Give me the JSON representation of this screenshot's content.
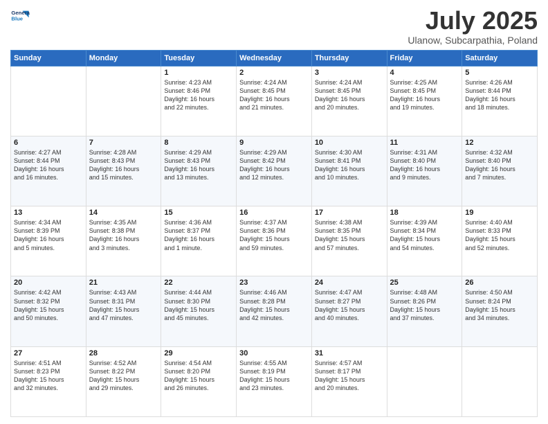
{
  "header": {
    "logo_line1": "General",
    "logo_line2": "Blue",
    "title": "July 2025",
    "location": "Ulanow, Subcarpathia, Poland"
  },
  "days_of_week": [
    "Sunday",
    "Monday",
    "Tuesday",
    "Wednesday",
    "Thursday",
    "Friday",
    "Saturday"
  ],
  "weeks": [
    [
      {
        "day": "",
        "info": ""
      },
      {
        "day": "",
        "info": ""
      },
      {
        "day": "1",
        "info": "Sunrise: 4:23 AM\nSunset: 8:46 PM\nDaylight: 16 hours\nand 22 minutes."
      },
      {
        "day": "2",
        "info": "Sunrise: 4:24 AM\nSunset: 8:45 PM\nDaylight: 16 hours\nand 21 minutes."
      },
      {
        "day": "3",
        "info": "Sunrise: 4:24 AM\nSunset: 8:45 PM\nDaylight: 16 hours\nand 20 minutes."
      },
      {
        "day": "4",
        "info": "Sunrise: 4:25 AM\nSunset: 8:45 PM\nDaylight: 16 hours\nand 19 minutes."
      },
      {
        "day": "5",
        "info": "Sunrise: 4:26 AM\nSunset: 8:44 PM\nDaylight: 16 hours\nand 18 minutes."
      }
    ],
    [
      {
        "day": "6",
        "info": "Sunrise: 4:27 AM\nSunset: 8:44 PM\nDaylight: 16 hours\nand 16 minutes."
      },
      {
        "day": "7",
        "info": "Sunrise: 4:28 AM\nSunset: 8:43 PM\nDaylight: 16 hours\nand 15 minutes."
      },
      {
        "day": "8",
        "info": "Sunrise: 4:29 AM\nSunset: 8:43 PM\nDaylight: 16 hours\nand 13 minutes."
      },
      {
        "day": "9",
        "info": "Sunrise: 4:29 AM\nSunset: 8:42 PM\nDaylight: 16 hours\nand 12 minutes."
      },
      {
        "day": "10",
        "info": "Sunrise: 4:30 AM\nSunset: 8:41 PM\nDaylight: 16 hours\nand 10 minutes."
      },
      {
        "day": "11",
        "info": "Sunrise: 4:31 AM\nSunset: 8:40 PM\nDaylight: 16 hours\nand 9 minutes."
      },
      {
        "day": "12",
        "info": "Sunrise: 4:32 AM\nSunset: 8:40 PM\nDaylight: 16 hours\nand 7 minutes."
      }
    ],
    [
      {
        "day": "13",
        "info": "Sunrise: 4:34 AM\nSunset: 8:39 PM\nDaylight: 16 hours\nand 5 minutes."
      },
      {
        "day": "14",
        "info": "Sunrise: 4:35 AM\nSunset: 8:38 PM\nDaylight: 16 hours\nand 3 minutes."
      },
      {
        "day": "15",
        "info": "Sunrise: 4:36 AM\nSunset: 8:37 PM\nDaylight: 16 hours\nand 1 minute."
      },
      {
        "day": "16",
        "info": "Sunrise: 4:37 AM\nSunset: 8:36 PM\nDaylight: 15 hours\nand 59 minutes."
      },
      {
        "day": "17",
        "info": "Sunrise: 4:38 AM\nSunset: 8:35 PM\nDaylight: 15 hours\nand 57 minutes."
      },
      {
        "day": "18",
        "info": "Sunrise: 4:39 AM\nSunset: 8:34 PM\nDaylight: 15 hours\nand 54 minutes."
      },
      {
        "day": "19",
        "info": "Sunrise: 4:40 AM\nSunset: 8:33 PM\nDaylight: 15 hours\nand 52 minutes."
      }
    ],
    [
      {
        "day": "20",
        "info": "Sunrise: 4:42 AM\nSunset: 8:32 PM\nDaylight: 15 hours\nand 50 minutes."
      },
      {
        "day": "21",
        "info": "Sunrise: 4:43 AM\nSunset: 8:31 PM\nDaylight: 15 hours\nand 47 minutes."
      },
      {
        "day": "22",
        "info": "Sunrise: 4:44 AM\nSunset: 8:30 PM\nDaylight: 15 hours\nand 45 minutes."
      },
      {
        "day": "23",
        "info": "Sunrise: 4:46 AM\nSunset: 8:28 PM\nDaylight: 15 hours\nand 42 minutes."
      },
      {
        "day": "24",
        "info": "Sunrise: 4:47 AM\nSunset: 8:27 PM\nDaylight: 15 hours\nand 40 minutes."
      },
      {
        "day": "25",
        "info": "Sunrise: 4:48 AM\nSunset: 8:26 PM\nDaylight: 15 hours\nand 37 minutes."
      },
      {
        "day": "26",
        "info": "Sunrise: 4:50 AM\nSunset: 8:24 PM\nDaylight: 15 hours\nand 34 minutes."
      }
    ],
    [
      {
        "day": "27",
        "info": "Sunrise: 4:51 AM\nSunset: 8:23 PM\nDaylight: 15 hours\nand 32 minutes."
      },
      {
        "day": "28",
        "info": "Sunrise: 4:52 AM\nSunset: 8:22 PM\nDaylight: 15 hours\nand 29 minutes."
      },
      {
        "day": "29",
        "info": "Sunrise: 4:54 AM\nSunset: 8:20 PM\nDaylight: 15 hours\nand 26 minutes."
      },
      {
        "day": "30",
        "info": "Sunrise: 4:55 AM\nSunset: 8:19 PM\nDaylight: 15 hours\nand 23 minutes."
      },
      {
        "day": "31",
        "info": "Sunrise: 4:57 AM\nSunset: 8:17 PM\nDaylight: 15 hours\nand 20 minutes."
      },
      {
        "day": "",
        "info": ""
      },
      {
        "day": "",
        "info": ""
      }
    ]
  ]
}
